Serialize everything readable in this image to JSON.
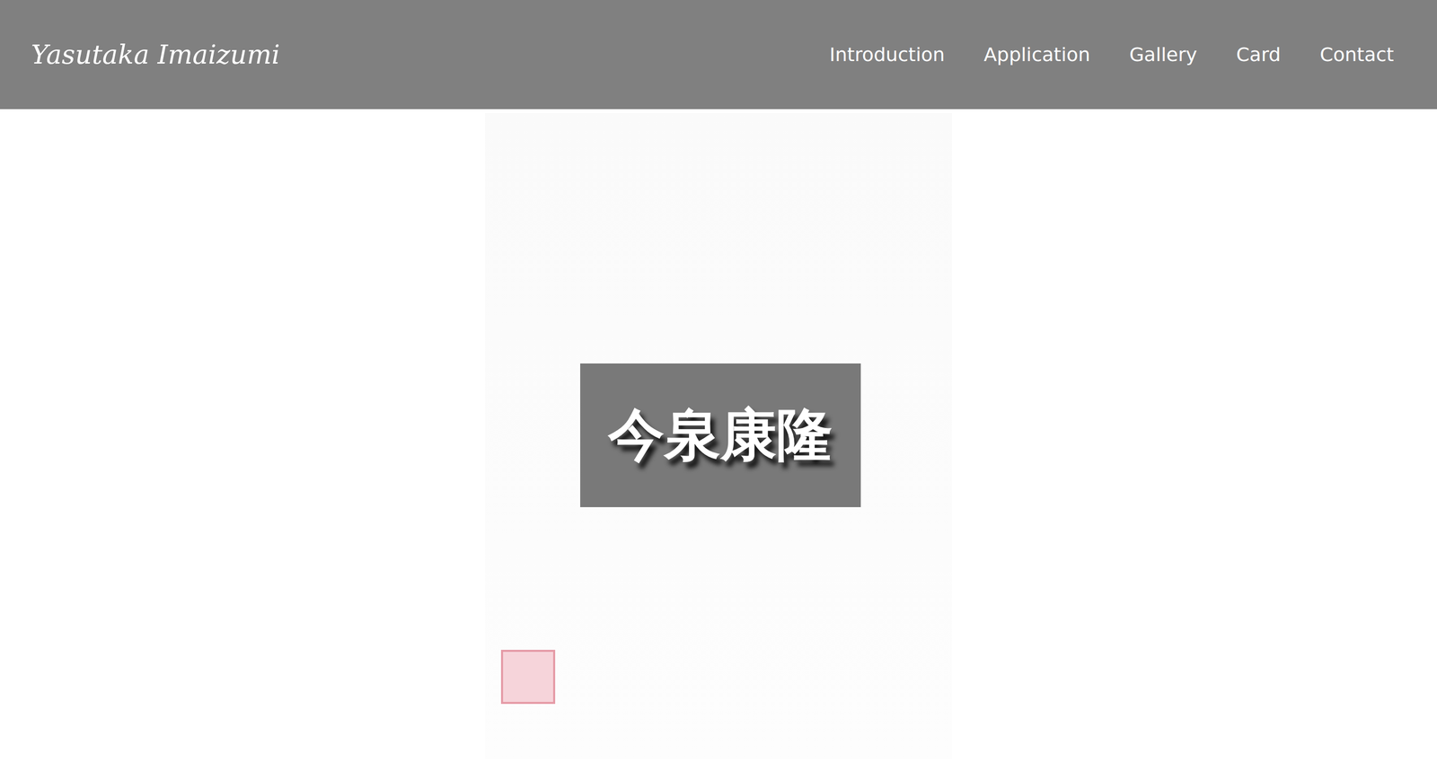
{
  "header": {
    "logo": "Yasutaka Imaizumi",
    "nav": [
      "Introduction",
      "Application",
      "Gallery",
      "Card",
      "Contact"
    ]
  },
  "hero": {
    "title": "今泉康隆"
  }
}
